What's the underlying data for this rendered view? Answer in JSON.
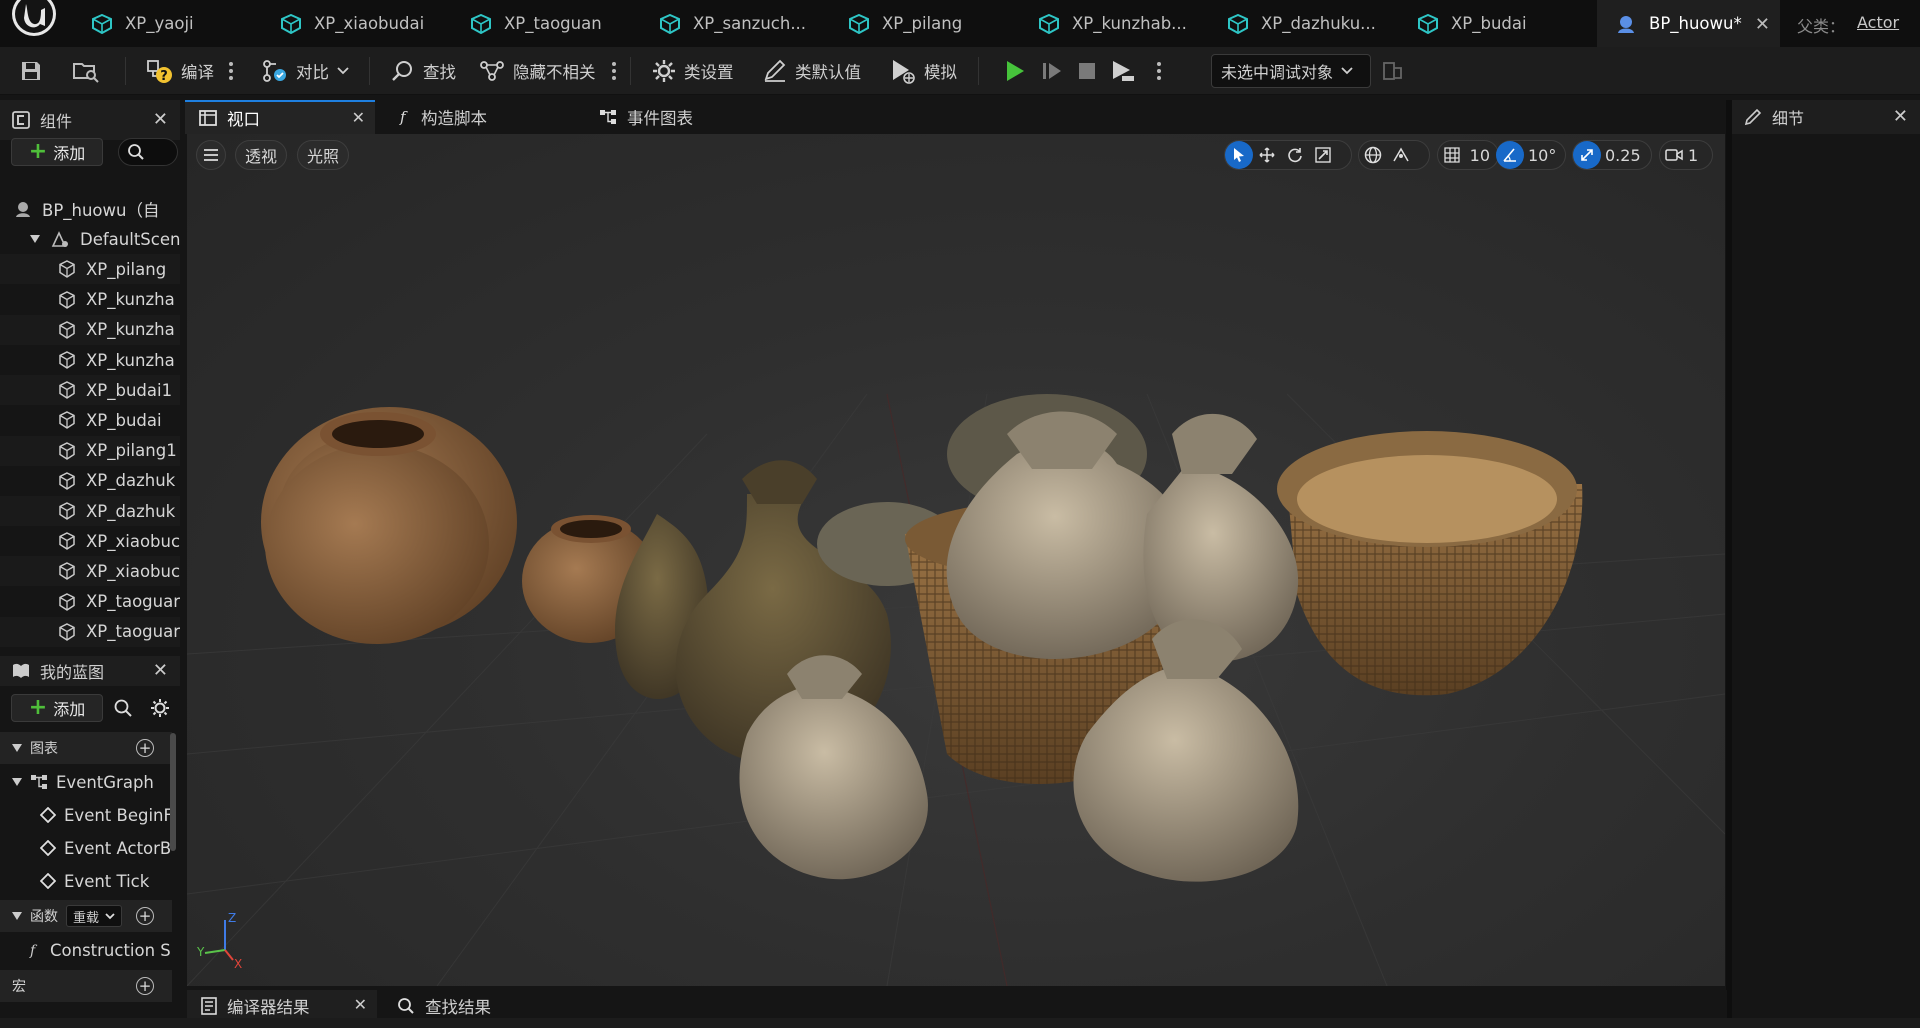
{
  "tabs": [
    {
      "label": "XP_yaoji",
      "active": false
    },
    {
      "label": "XP_xiaobudai",
      "active": false
    },
    {
      "label": "XP_taoguan",
      "active": false
    },
    {
      "label": "XP_sanzuch...",
      "active": false
    },
    {
      "label": "XP_pilang",
      "active": false
    },
    {
      "label": "XP_kunzhab...",
      "active": false
    },
    {
      "label": "XP_dazhuku...",
      "active": false
    },
    {
      "label": "XP_budai",
      "active": false
    },
    {
      "label": "BP_huowu*",
      "active": true
    }
  ],
  "parent": {
    "label": "父类：",
    "value": "Actor"
  },
  "toolbar": {
    "compile": "编译",
    "diff": "对比",
    "find": "查找",
    "hide_unrelated": "隐藏不相关",
    "class_settings": "类设置",
    "class_defaults": "类默认值",
    "simulate": "模拟",
    "debug_target": "未选中调试对象"
  },
  "components_panel": {
    "title": "组件",
    "add_label": "添加",
    "items": [
      {
        "label": "BP_huowu（自",
        "level": 0
      },
      {
        "label": "DefaultScene",
        "level": 1
      },
      {
        "label": "XP_pilang",
        "level": 2
      },
      {
        "label": "XP_kunzha",
        "level": 2
      },
      {
        "label": "XP_kunzha",
        "level": 2
      },
      {
        "label": "XP_kunzha",
        "level": 2
      },
      {
        "label": "XP_budai1",
        "level": 2
      },
      {
        "label": "XP_budai",
        "level": 2
      },
      {
        "label": "XP_pilang1",
        "level": 2
      },
      {
        "label": "XP_dazhuk",
        "level": 2
      },
      {
        "label": "XP_dazhuk",
        "level": 2
      },
      {
        "label": "XP_xiaobuc",
        "level": 2
      },
      {
        "label": "XP_xiaobuc",
        "level": 2
      },
      {
        "label": "XP_taoguar",
        "level": 2
      },
      {
        "label": "XP_taoguar",
        "level": 2
      }
    ]
  },
  "my_blueprint": {
    "title": "我的蓝图",
    "add_label": "添加",
    "graphs_section": "图表",
    "event_graph": "EventGraph",
    "events": [
      "Event BeginF",
      "Event ActorB",
      "Event Tick"
    ],
    "functions_section": "函数",
    "override_label": "重载",
    "construction": "Construction S",
    "macros_section": "宏"
  },
  "viewport": {
    "tabs": [
      "视口",
      "构造脚本",
      "事件图表"
    ],
    "perspective": "透视",
    "lighting": "光照",
    "grid_snap": "10",
    "rotation_snap": "10°",
    "scale_snap": "0.25",
    "camera_speed": "1",
    "axis": {
      "x": "X",
      "y": "Y",
      "z": "Z"
    }
  },
  "details_panel": {
    "title": "细节"
  },
  "bottom_tabs": {
    "compiler_results": "编译器结果",
    "find_results": "查找结果"
  },
  "colors": {
    "accent": "#1e7fe0",
    "add_green": "#4fbf3a",
    "play_green": "#46c33b"
  }
}
